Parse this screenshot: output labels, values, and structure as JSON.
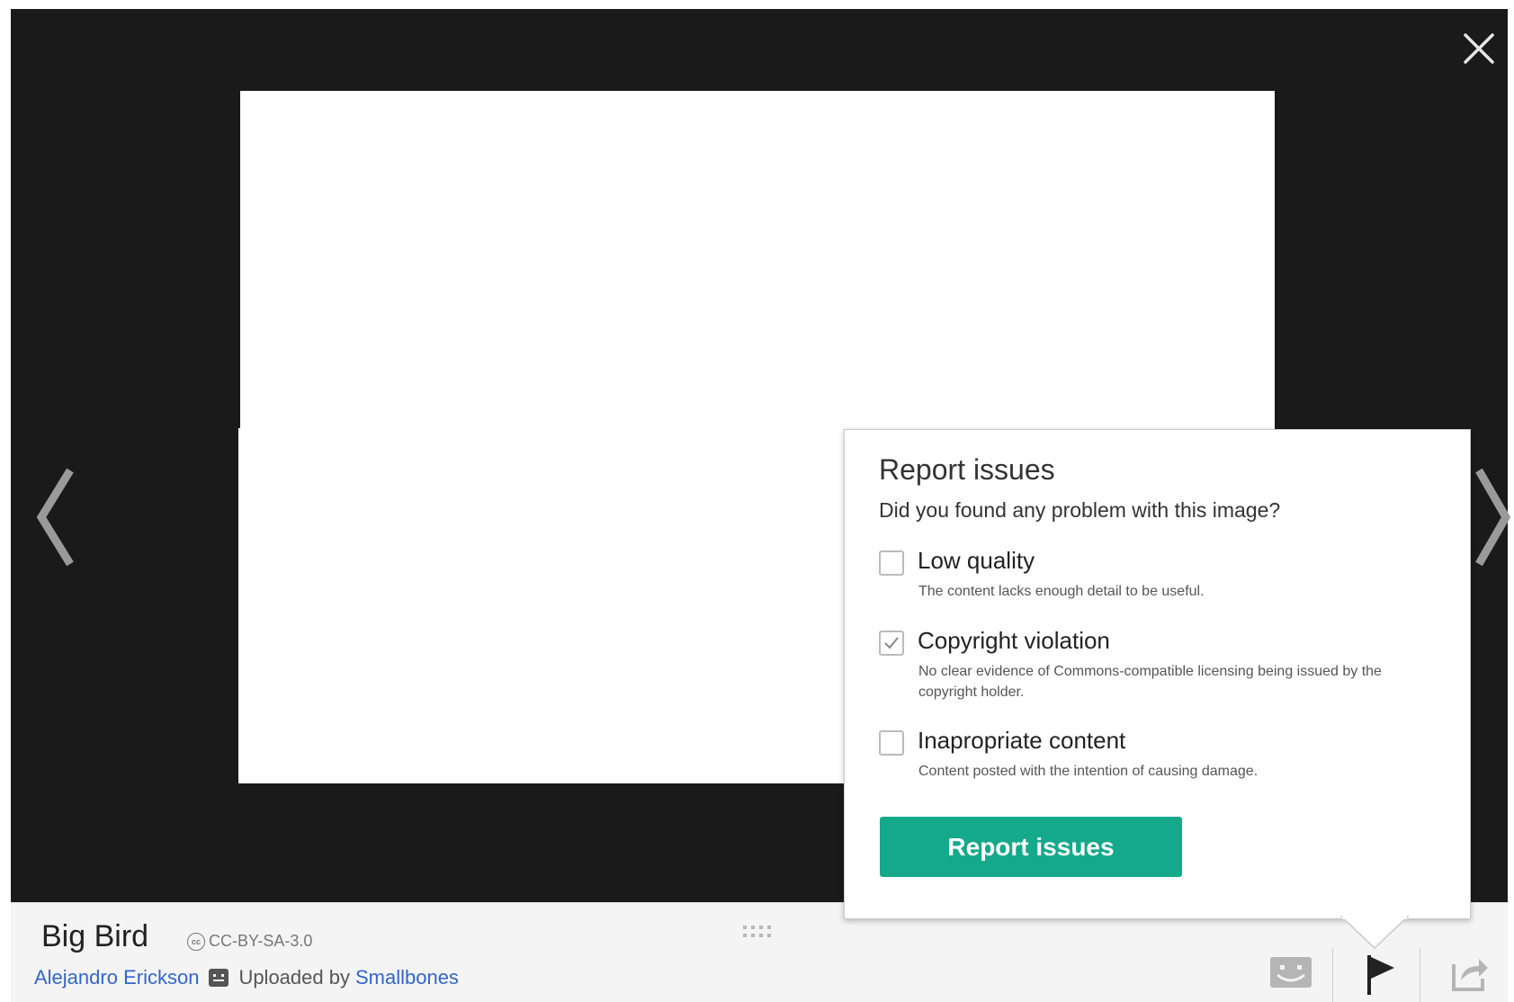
{
  "viewer": {
    "close_icon": "close-icon",
    "prev_icon": "chevron-left-icon",
    "next_icon": "chevron-right-icon"
  },
  "footer": {
    "title": "Big Bird",
    "license": "CC-BY-SA-3.0",
    "author": "Alejandro Erickson",
    "uploaded_prefix": "Uploaded by",
    "uploader": "Smallbones"
  },
  "toolbar": {
    "icons": [
      "face-icon",
      "flag-icon",
      "share-icon"
    ]
  },
  "report_popup": {
    "title": "Report issues",
    "question": "Did you found any problem with this image?",
    "options": [
      {
        "label": "Low quality",
        "description": "The content lacks enough detail to be useful.",
        "checked": false
      },
      {
        "label": "Copyright violation",
        "description": "No clear evidence of Commons-compatible licensing being issued by the copyright holder.",
        "checked": true
      },
      {
        "label": "Inapropriate content",
        "description": "Content posted with the intention of causing damage.",
        "checked": false
      }
    ],
    "submit_label": "Report issues",
    "accent_color": "#14a98b"
  }
}
